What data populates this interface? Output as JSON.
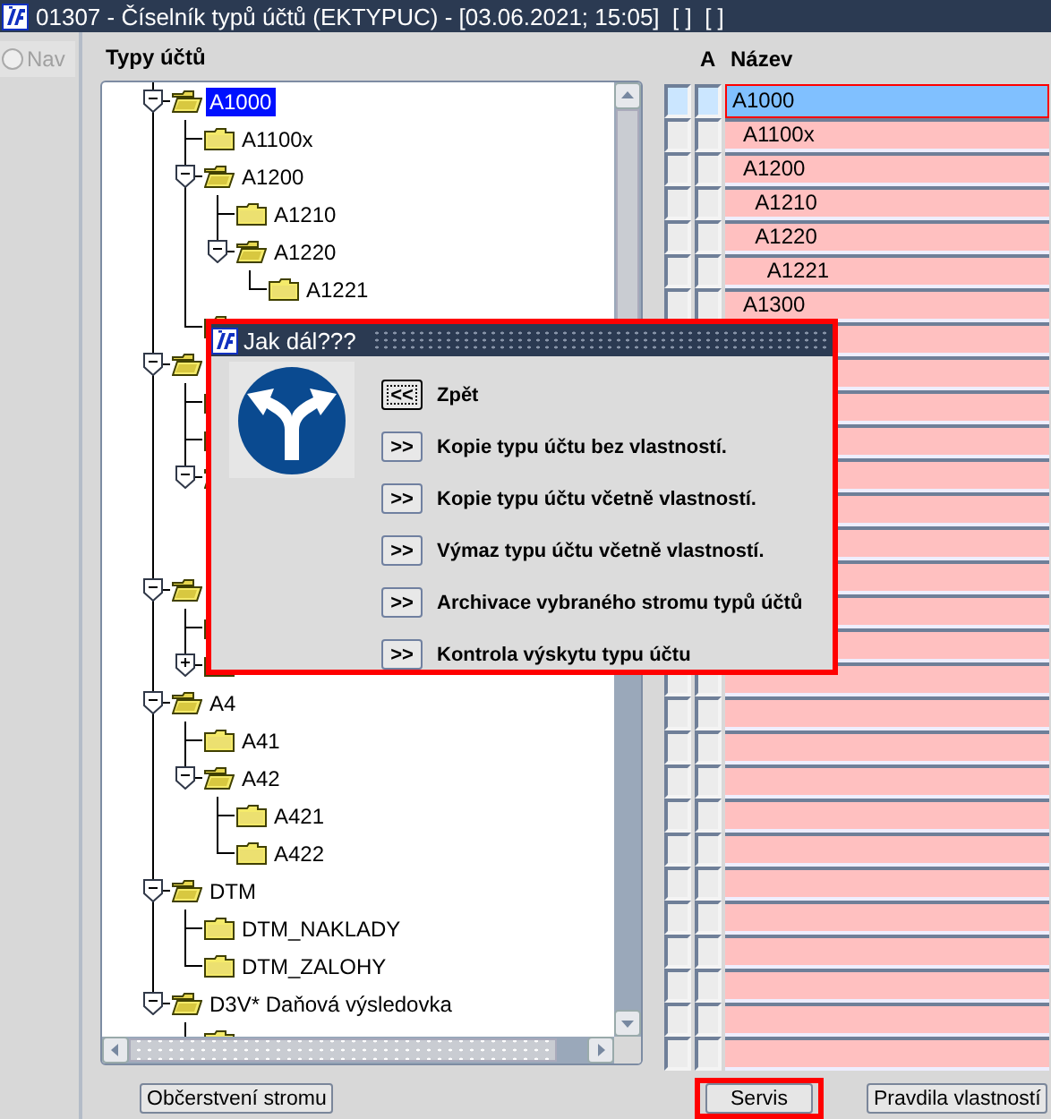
{
  "window": {
    "title": "01307 - Číselník typů účtů (EKTYPUC) - [03.06.2021; 15:05]  [ ]  [ ]"
  },
  "nav": {
    "label": "Nav",
    "selected": false,
    "disabled": true
  },
  "tree": {
    "heading": "Typy účtů",
    "nodes": [
      {
        "kind": "folder",
        "label": "A1000",
        "selected": true,
        "expanded": true,
        "children": [
          {
            "kind": "folder",
            "label": "A1100x",
            "selected": false
          },
          {
            "kind": "folder",
            "label": "A1200",
            "selected": false,
            "expanded": true,
            "children": [
              {
                "kind": "folder",
                "label": "A1210",
                "selected": false
              },
              {
                "kind": "folder",
                "label": "A1220",
                "selected": false,
                "expanded": true,
                "children": [
                  {
                    "kind": "folder",
                    "label": "A1221",
                    "selected": false
                  }
                ]
              }
            ]
          },
          {
            "kind": "folder"
          }
        ]
      },
      {
        "kind": "folder",
        "expanded": true,
        "children": [
          {
            "kind": "folder"
          },
          {
            "kind": "folder"
          },
          {
            "kind": "folder",
            "expanded": true,
            "children": [
              {
                "kind": "folder"
              },
              {
                "kind": "folder"
              }
            ]
          }
        ]
      },
      {
        "kind": "folder",
        "expanded": true,
        "children": [
          {
            "kind": "folder"
          },
          {
            "kind": "folder",
            "expanded": false
          }
        ]
      },
      {
        "kind": "folder",
        "label": "A4",
        "selected": false,
        "expanded": true,
        "children": [
          {
            "kind": "folder",
            "label": "A41",
            "selected": false
          },
          {
            "kind": "folder",
            "label": "A42",
            "selected": false,
            "expanded": true,
            "children": [
              {
                "kind": "folder",
                "label": "A421",
                "selected": false
              },
              {
                "kind": "folder",
                "label": "A422",
                "selected": false
              }
            ]
          }
        ]
      },
      {
        "kind": "folder",
        "label": "DTM",
        "selected": false,
        "expanded": true,
        "children": [
          {
            "kind": "folder",
            "label": "DTM_NAKLADY",
            "selected": false
          },
          {
            "kind": "folder",
            "label": "DTM_ZALOHY",
            "selected": false
          }
        ]
      },
      {
        "kind": "folder",
        "label": "D3V* Daňová výsledovka",
        "selected": false,
        "expanded": true,
        "children": [
          {
            "kind": "folder"
          }
        ]
      }
    ]
  },
  "grid": {
    "headers": [
      "A",
      "Název"
    ],
    "rows": [
      {
        "name": "A1000",
        "selected": true
      },
      {
        "name": "  A1100x",
        "selected": false
      },
      {
        "name": "  A1200",
        "selected": false
      },
      {
        "name": "    A1210",
        "selected": false
      },
      {
        "name": "    A1220",
        "selected": false
      },
      {
        "name": "      A1221",
        "selected": false
      },
      {
        "name": "  A1300",
        "selected": false
      },
      {
        "selected": false
      },
      {
        "selected": false
      },
      {
        "selected": false
      },
      {
        "selected": false
      },
      {
        "selected": false
      },
      {
        "selected": false
      },
      {
        "selected": false
      },
      {
        "selected": false
      },
      {
        "selected": false
      },
      {
        "selected": false
      },
      {
        "selected": false
      },
      {
        "selected": false
      },
      {
        "selected": false
      },
      {
        "selected": false
      },
      {
        "selected": false
      },
      {
        "selected": false
      },
      {
        "selected": false
      },
      {
        "selected": false
      },
      {
        "selected": false
      },
      {
        "selected": false
      },
      {
        "selected": false
      },
      {
        "selected": false
      }
    ]
  },
  "dialog": {
    "title": "Jak dál???",
    "highlighted": true,
    "options": [
      {
        "button": "<<",
        "label": "Zpět",
        "focused": true
      },
      {
        "button": ">>",
        "label": "Kopie typu účtu bez vlastností.",
        "focused": false
      },
      {
        "button": ">>",
        "label": "Kopie typu účtu včetně vlastností.",
        "focused": false
      },
      {
        "button": ">>",
        "label": "Výmaz typu účtu včetně vlastností.",
        "focused": false
      },
      {
        "button": ">>",
        "label": "Archivace vybraného stromu typů účtů",
        "focused": false
      },
      {
        "button": ">>",
        "label": "Kontrola výskytu typu účtu",
        "focused": false
      }
    ]
  },
  "buttons": [
    {
      "label": "Občerstvení stromu",
      "highlighted": false
    },
    {
      "label": "Servis",
      "highlighted": true
    },
    {
      "label": "Pravdila vlastností",
      "highlighted": false
    }
  ]
}
